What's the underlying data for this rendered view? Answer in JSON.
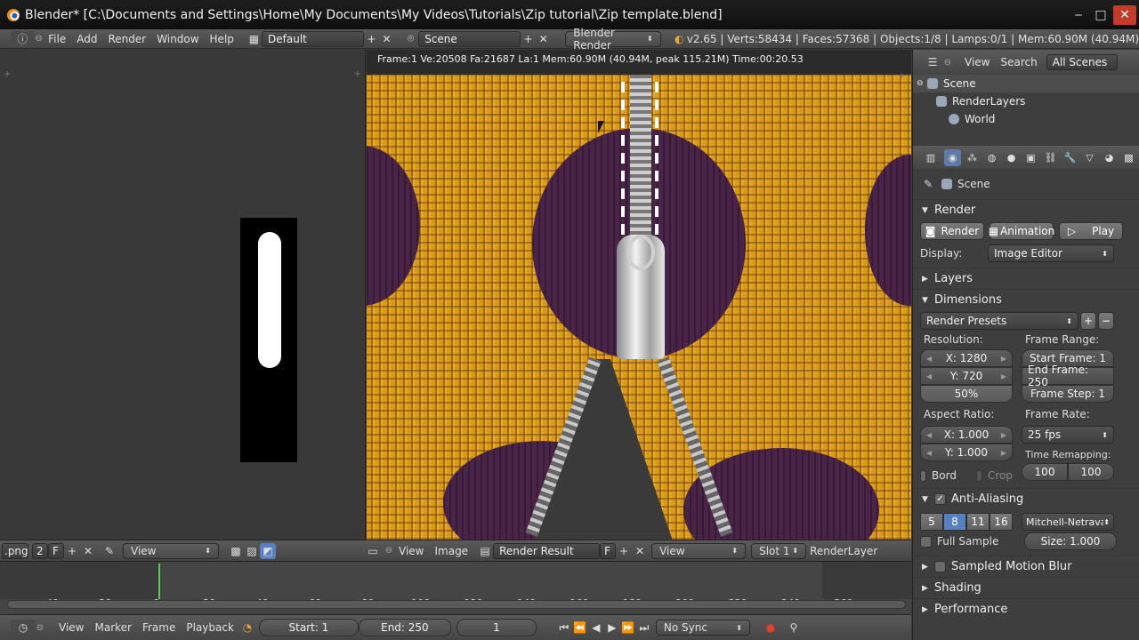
{
  "window": {
    "title": "Blender* [C:\\Documents and Settings\\Home\\My Documents\\My Videos\\Tutorials\\Zip tutorial\\Zip template.blend]",
    "minimize": "‒",
    "maximize": "□",
    "close": "✕"
  },
  "info_header": {
    "menus": [
      "File",
      "Add",
      "Render",
      "Window",
      "Help"
    ],
    "layout": "Default",
    "scene": "Scene",
    "engine": "Blender Render",
    "stats": "v2.65 | Verts:58434 | Faces:57368 | Objects:1/8 | Lamps:0/1 | Mem:60.90M (40.94M)"
  },
  "render_view": {
    "stats": "Frame:1 Ve:20508 Fa:21687 La:1 Mem:60.90M (40.94M, peak 115.21M) Time:00:20.53"
  },
  "left_header": {
    "file_ext": ".png",
    "users": "2",
    "fake": "F",
    "view": "View"
  },
  "image_header": {
    "view": "View",
    "image": "Image",
    "image_name": "Render Result",
    "fake": "F",
    "view_dd": "View",
    "slot": "Slot 1",
    "layer": "RenderLayer"
  },
  "timeline": {
    "ticks": [
      "-40",
      "-20",
      "0",
      "20",
      "40",
      "60",
      "80",
      "100",
      "120",
      "140",
      "160",
      "180",
      "200",
      "220",
      "240",
      "260"
    ],
    "current_frame": 0
  },
  "timeline_header": {
    "view": "View",
    "marker": "Marker",
    "frame": "Frame",
    "playback": "Playback",
    "start": "Start: 1",
    "end": "End: 250",
    "current": "1",
    "sync": "No Sync"
  },
  "outliner": {
    "view": "View",
    "search": "Search",
    "filter": "All Scenes",
    "items": [
      "Scene",
      "RenderLayers",
      "World"
    ]
  },
  "properties": {
    "context": "Scene",
    "render_panel": "Render",
    "render_btn": "Render",
    "animation_btn": "Animation",
    "play_btn": "Play",
    "display_label": "Display:",
    "display_value": "Image Editor",
    "layers_panel": "Layers",
    "dimensions_panel": "Dimensions",
    "render_presets": "Render Presets",
    "resolution_label": "Resolution:",
    "res_x": "X: 1280",
    "res_y": "Y: 720",
    "res_pct": "50%",
    "frame_range_label": "Frame Range:",
    "start_frame": "Start Frame: 1",
    "end_frame": "End Frame: 250",
    "frame_step": "Frame Step: 1",
    "aspect_label": "Aspect Ratio:",
    "aspect_x": "X: 1.000",
    "aspect_y": "Y: 1.000",
    "frame_rate_label": "Frame Rate:",
    "frame_rate": "25 fps",
    "bord": "Bord",
    "crop": "Crop",
    "time_remap_label": "Time Remapping:",
    "remap_old": "100",
    "remap_new": "100",
    "aa_panel": "Anti-Aliasing",
    "aa_samples": [
      "5",
      "8",
      "11",
      "16"
    ],
    "aa_selected": "8",
    "aa_filter": "Mitchell-Netravali",
    "full_sample": "Full Sample",
    "aa_size": "Size: 1.000",
    "mb_panel": "Sampled Motion Blur",
    "shading_panel": "Shading",
    "performance_panel": "Performance"
  }
}
